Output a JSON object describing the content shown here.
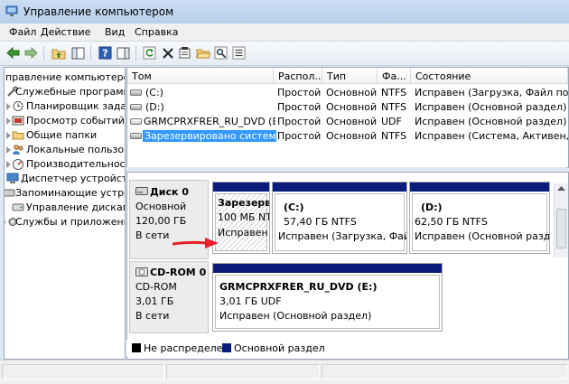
{
  "window": {
    "title": "Управление компьютером"
  },
  "menu": {
    "file": "Файл",
    "action": "Действие",
    "view": "Вид",
    "help": "Справка"
  },
  "tree": {
    "root": "правление компьютером",
    "items": [
      {
        "label": "Служебные программы",
        "icon": "tools-icon"
      },
      {
        "label": "Планировщик задан",
        "icon": "scheduler-icon"
      },
      {
        "label": "Просмотр событий",
        "icon": "event-viewer-icon"
      },
      {
        "label": "Общие папки",
        "icon": "shared-folders-icon"
      },
      {
        "label": "Локальные пользов",
        "icon": "local-users-icon"
      },
      {
        "label": "Производительность",
        "icon": "performance-icon"
      },
      {
        "label": "Диспетчер устройст",
        "icon": "device-manager-icon"
      },
      {
        "label": "Запоминающие устрой",
        "icon": "storage-icon"
      },
      {
        "label": "Управление дискам",
        "icon": "disk-management-icon"
      },
      {
        "label": "Службы и приложения",
        "icon": "services-icon"
      }
    ]
  },
  "volumes": {
    "headers": {
      "name": "Том",
      "layout": "Распол...",
      "type": "Тип",
      "fs": "Фа...",
      "status": "Состояние"
    },
    "rows": [
      {
        "name": "(C:)",
        "layout": "Простой",
        "type": "Основной",
        "fs": "NTFS",
        "status": "Исправен (Загрузка, Файл подка"
      },
      {
        "name": "(D:)",
        "layout": "Простой",
        "type": "Основной",
        "fs": "NTFS",
        "status": "Исправен (Основной раздел)"
      },
      {
        "name": "GRMCPRXFRER_RU_DVD (E:)",
        "layout": "Простой",
        "type": "Основной",
        "fs": "UDF",
        "status": "Исправен (Основной раздел)"
      },
      {
        "name": "Зарезервировано системой",
        "layout": "Простой",
        "type": "Основной",
        "fs": "NTFS",
        "status": "Исправен (Система, Активен, Ос"
      }
    ]
  },
  "disks": [
    {
      "name": "Диск 0",
      "kind": "Основной",
      "size": "120,00 ГБ",
      "state": "В сети",
      "partitions": [
        {
          "line1": "Зарезерв",
          "line2": "100 МБ NT",
          "line3": "Исправен"
        },
        {
          "line1": "(C:)",
          "line2": "57,40 ГБ NTFS",
          "line3": "Исправен (Загрузка, Файл п"
        },
        {
          "line1": "(D:)",
          "line2": "62,50 ГБ NTFS",
          "line3": "Исправен (Основной раздел"
        }
      ]
    },
    {
      "name": "CD-ROM 0",
      "kind": "CD-ROM",
      "size": "3,01 ГБ",
      "state": "В сети",
      "partitions": [
        {
          "line1": "GRMCPRXFRER_RU_DVD  (E:)",
          "line2": "3,01 ГБ UDF",
          "line3": "Исправен (Основной раздел)"
        }
      ]
    }
  ],
  "legend": {
    "unallocated": "Не распределен",
    "primary": "Основной раздел"
  },
  "colors": {
    "primary_bar": "#0a1c7c",
    "unallocated": "#000000",
    "selection": "#3399ff",
    "arrow": "#e8202a"
  }
}
